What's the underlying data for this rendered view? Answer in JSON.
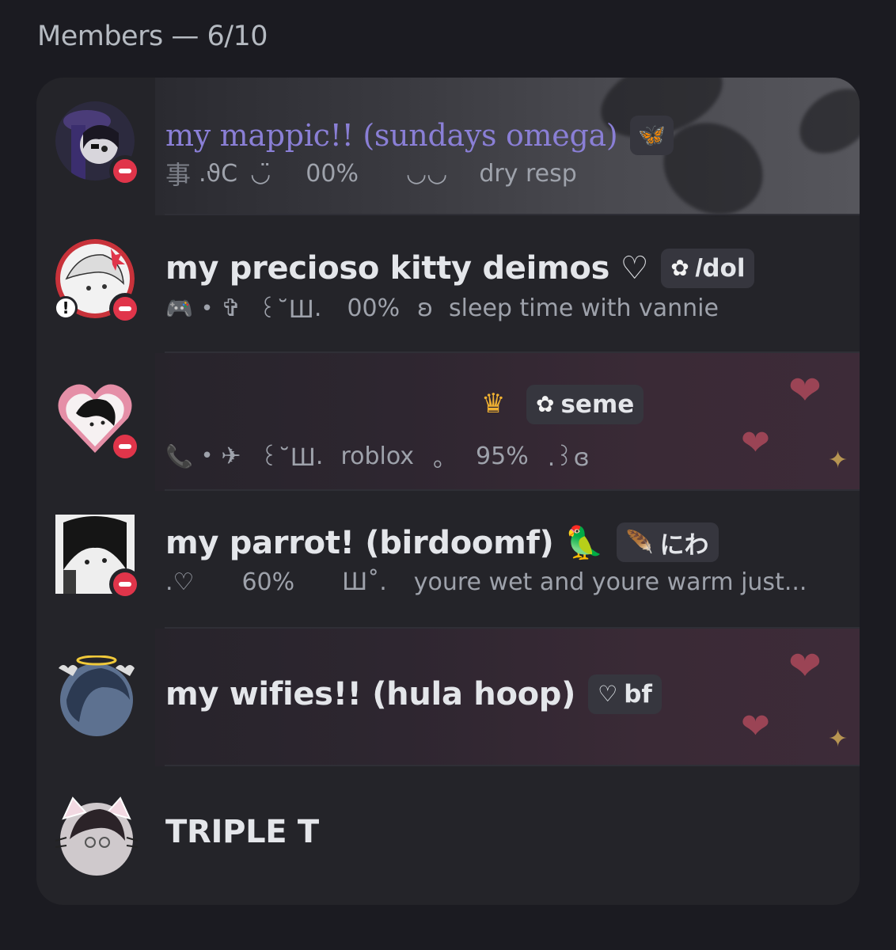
{
  "header": {
    "title": "Members — 6/10"
  },
  "members": [
    {
      "name": "my mappic!! (sundays omega)",
      "badge_emoji": "🦋",
      "badge_text": "",
      "status": {
        "parts": [
          "事",
          ".ϑC",
          "◡̈",
          "00%",
          "◡◡",
          "dry resp"
        ]
      },
      "status_indicator": "do-not-disturb"
    },
    {
      "name": "my precioso kitty deimos ♡",
      "badge_emoji": "✿",
      "badge_text": "𝐼dol",
      "status": {
        "activity_icon": "🎮",
        "parts": [
          "•",
          "✞",
          "꒰˘Ш",
          ".",
          "00%",
          "ʚ",
          "sleep time with vannie"
        ]
      },
      "status_indicator": "do-not-disturb"
    },
    {
      "name": "",
      "crown": "♛",
      "badge_emoji": "✿",
      "badge_text": "seme",
      "status": {
        "activity_icon": "📞",
        "parts": [
          "•",
          "✈",
          "꒰˘Ш",
          ".",
          "roblox",
          "。",
          "95%",
          ".꒱ɞ"
        ]
      },
      "status_indicator": "do-not-disturb"
    },
    {
      "name": "my parrot! (birdoomf) 🦜",
      "badge_emoji": "🪶",
      "badge_text": "にわ",
      "status": {
        "parts": [
          ".♡",
          "60%",
          "Ш˚.",
          "youre wet and youre warm just..."
        ]
      },
      "status_indicator": "do-not-disturb"
    },
    {
      "name": "my wifies!! (hula hoop)",
      "badge_emoji": "♡",
      "badge_text": "bf",
      "status": {
        "parts": []
      },
      "status_indicator": "none"
    },
    {
      "name": "TRIPLE T",
      "badge_emoji": "",
      "badge_text": "",
      "status": {
        "parts": []
      },
      "status_indicator": "none"
    }
  ],
  "colors": {
    "background": "#1b1b21",
    "card": "#242429",
    "dnd": "#e0354a",
    "game_green": "#3ba55c",
    "name_purple": "#8a7fd6"
  }
}
